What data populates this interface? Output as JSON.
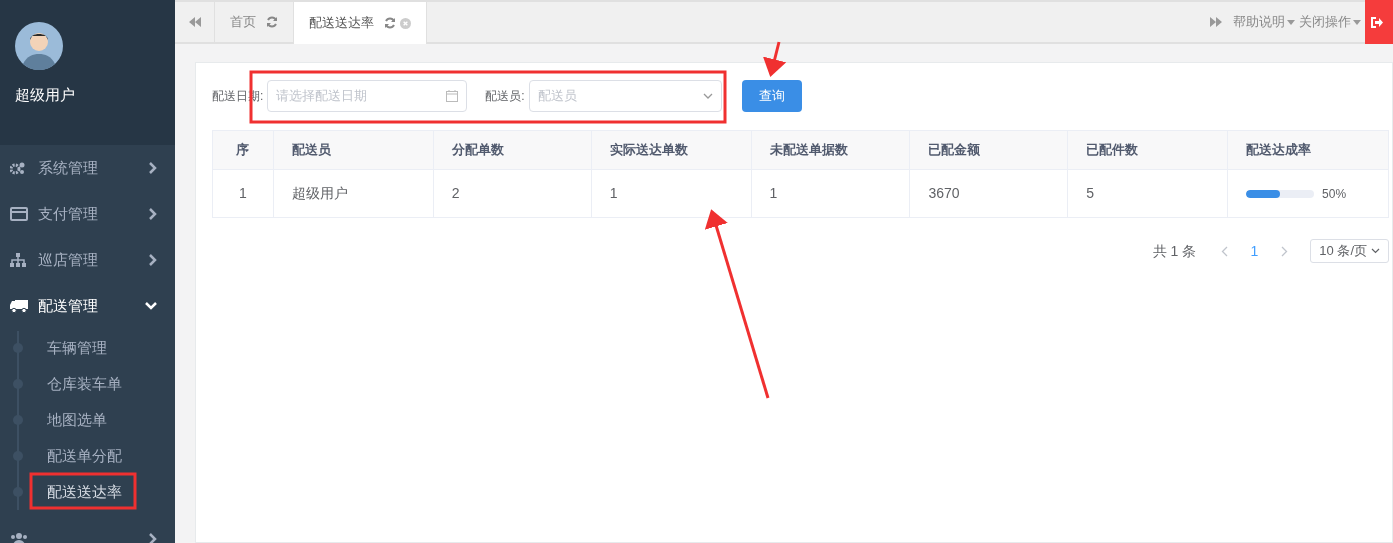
{
  "sidebar": {
    "user": {
      "name": "超级用户"
    },
    "items": [
      {
        "label": "系统管理",
        "kind": "gear",
        "expanded": false
      },
      {
        "label": "支付管理",
        "kind": "card",
        "expanded": false
      },
      {
        "label": "巡店管理",
        "kind": "sitemap",
        "expanded": false
      },
      {
        "label": "配送管理",
        "kind": "truck",
        "expanded": true,
        "children": [
          {
            "label": "车辆管理",
            "selected": false
          },
          {
            "label": "仓库装车单",
            "selected": false
          },
          {
            "label": "地图选单",
            "selected": false
          },
          {
            "label": "配送单分配",
            "selected": false
          },
          {
            "label": "配送送达率",
            "selected": true
          }
        ]
      },
      {
        "kind": "users",
        "expanded": false
      }
    ]
  },
  "tabs": [
    {
      "label": "首页",
      "selected": false,
      "closable": false
    },
    {
      "label": "配送送达率",
      "selected": true,
      "closable": true
    }
  ],
  "toolbar": {
    "menus": [
      "帮助说明",
      "关闭操作"
    ]
  },
  "filters": {
    "date_label": "配送日期:",
    "date_placeholder": "请选择配送日期",
    "courier_label": "配送员:",
    "courier_placeholder": "配送员",
    "query_button": "查询"
  },
  "table": {
    "columns": [
      "序",
      "配送员",
      "分配单数",
      "实际送达单数",
      "未配送单据数",
      "已配金额",
      "已配件数",
      "配送达成率"
    ],
    "rows": [
      {
        "cells": [
          "1",
          "超级用户",
          "2",
          "1",
          "1",
          "3670",
          "5"
        ],
        "level": 0.5,
        "reading": "50%"
      }
    ]
  },
  "pagination": {
    "total": "共 1 条",
    "pages": [
      {
        "label": "1",
        "selected": true
      }
    ],
    "page_size": "10 条/页"
  }
}
